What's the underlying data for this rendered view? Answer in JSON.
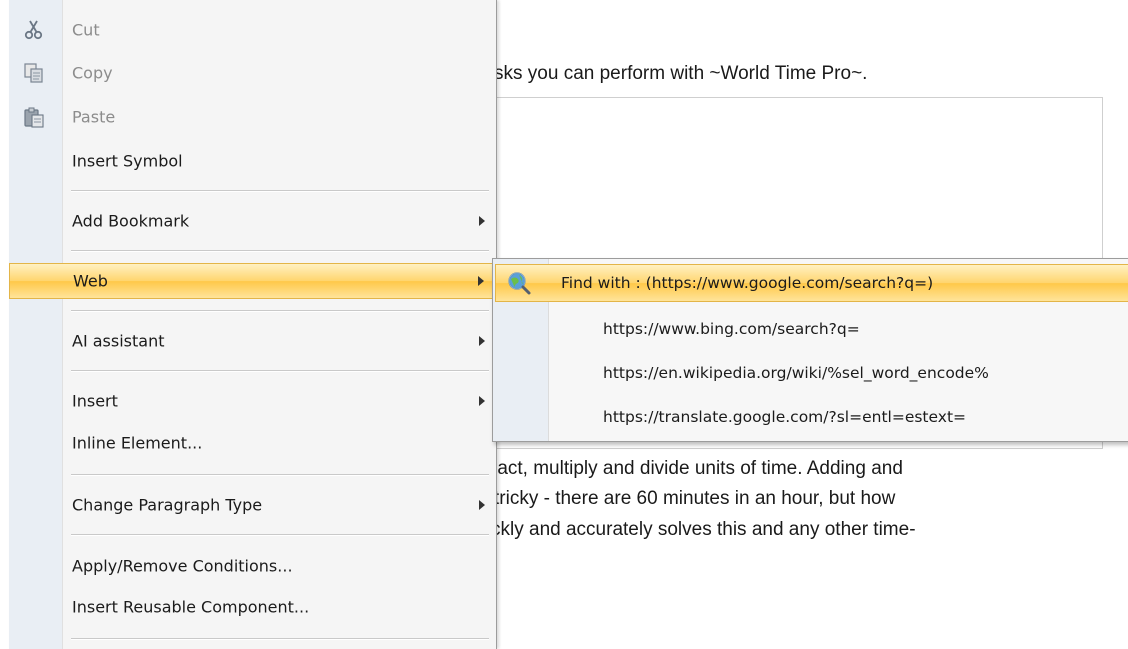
{
  "document": {
    "intro_line": "sks you can perform with ~World Time Pro~.",
    "body_lines": [
      "ract, multiply and divide units of time. Adding and",
      "tricky - there are 60 minutes in an hour, but how",
      "ckly and accurately solves this and any other time-"
    ]
  },
  "context_menu": {
    "items": [
      {
        "label": "Cut",
        "icon": "scissors-icon",
        "disabled": true
      },
      {
        "label": "Copy",
        "icon": "copy-icon",
        "disabled": true
      },
      {
        "label": "Paste",
        "icon": "paste-icon",
        "disabled": true
      },
      {
        "label": "Insert Symbol"
      },
      {
        "label": "Add Bookmark",
        "submenu": true
      },
      {
        "label": "Web",
        "submenu": true,
        "highlighted": true
      },
      {
        "label": "AI assistant",
        "submenu": true
      },
      {
        "label": "Insert",
        "submenu": true
      },
      {
        "label": "Inline Element..."
      },
      {
        "label": "Change Paragraph Type",
        "submenu": true
      },
      {
        "label": "Apply/Remove Conditions..."
      },
      {
        "label": "Insert Reusable Component..."
      }
    ]
  },
  "web_submenu": {
    "items": [
      {
        "label": "Find with : (https://www.google.com/search?q=)",
        "icon": "globe-search-icon",
        "highlighted": true
      },
      {
        "label": "https://www.bing.com/search?q="
      },
      {
        "label": "https://en.wikipedia.org/wiki/%sel_word_encode%"
      },
      {
        "label": "https://translate.google.com/?sl=entl=estext="
      }
    ]
  },
  "colors": {
    "highlight": "#ffd56e",
    "gutter": "#e9eef4",
    "menu_bg": "#f5f5f5"
  }
}
